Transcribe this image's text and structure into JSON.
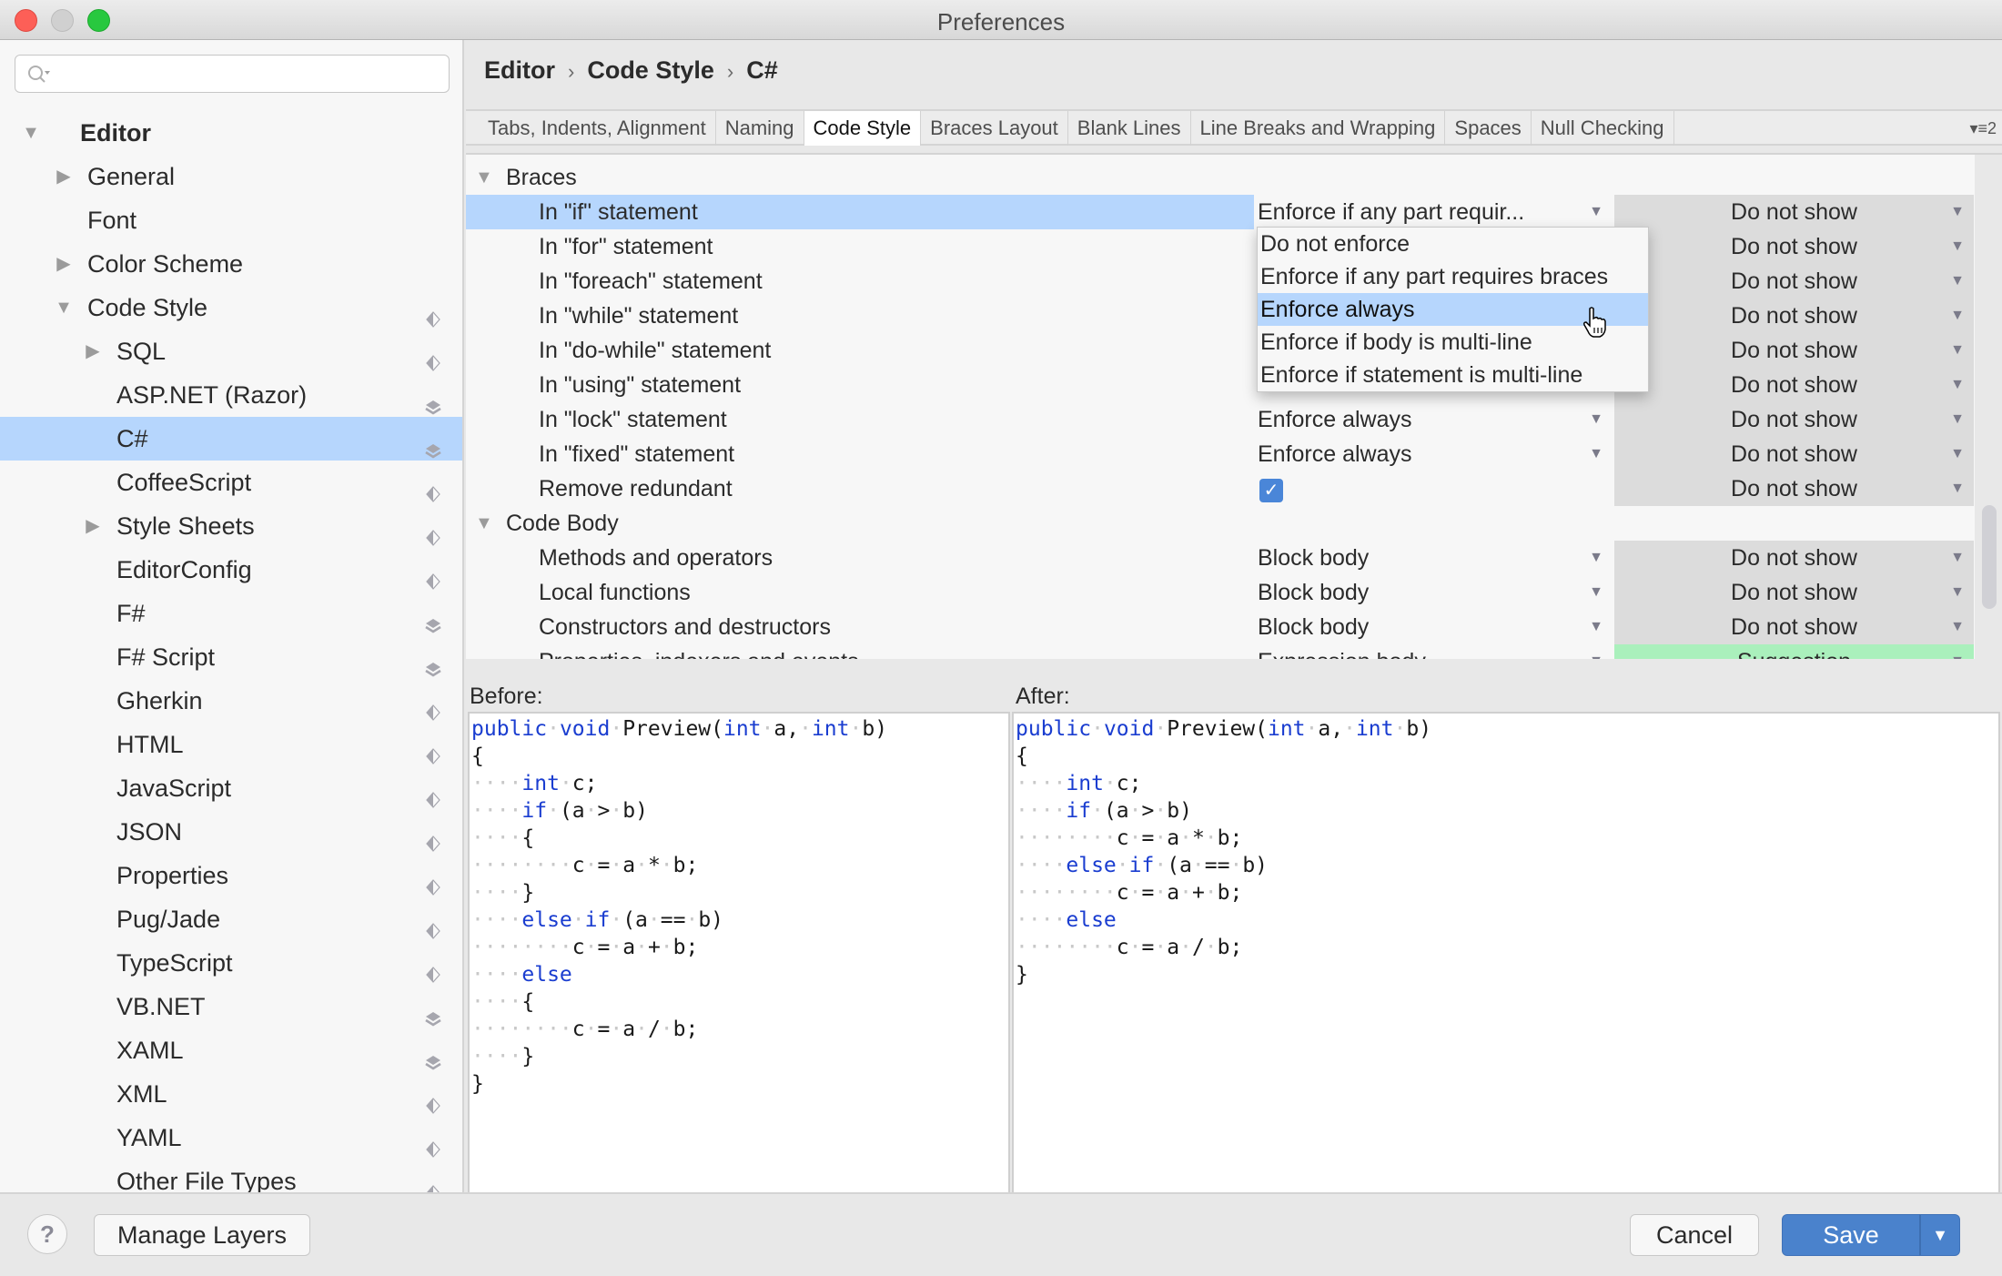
{
  "window": {
    "title": "Preferences"
  },
  "search": {
    "placeholder": ""
  },
  "sidebar": {
    "items": [
      {
        "label": "Editor",
        "level": 0,
        "expander": "expanded",
        "bold": true,
        "layer": ""
      },
      {
        "label": "General",
        "level": 1,
        "expander": "collapsed",
        "layer": ""
      },
      {
        "label": "Font",
        "level": 1,
        "expander": "",
        "layer": ""
      },
      {
        "label": "Color Scheme",
        "level": 1,
        "expander": "collapsed",
        "layer": ""
      },
      {
        "label": "Code Style",
        "level": 1,
        "expander": "expanded",
        "layer": "single"
      },
      {
        "label": "SQL",
        "level": 2,
        "expander": "collapsed",
        "layer": "single"
      },
      {
        "label": "ASP.NET (Razor)",
        "level": 2,
        "expander": "",
        "layer": "multi"
      },
      {
        "label": "C#",
        "level": 2,
        "expander": "",
        "layer": "multi",
        "selected": true
      },
      {
        "label": "CoffeeScript",
        "level": 2,
        "expander": "",
        "layer": "single"
      },
      {
        "label": "Style Sheets",
        "level": 2,
        "expander": "collapsed",
        "layer": "single"
      },
      {
        "label": "EditorConfig",
        "level": 2,
        "expander": "",
        "layer": "single"
      },
      {
        "label": "F#",
        "level": 2,
        "expander": "",
        "layer": "multi"
      },
      {
        "label": "F# Script",
        "level": 2,
        "expander": "",
        "layer": "multi"
      },
      {
        "label": "Gherkin",
        "level": 2,
        "expander": "",
        "layer": "single"
      },
      {
        "label": "HTML",
        "level": 2,
        "expander": "",
        "layer": "single"
      },
      {
        "label": "JavaScript",
        "level": 2,
        "expander": "",
        "layer": "single"
      },
      {
        "label": "JSON",
        "level": 2,
        "expander": "",
        "layer": "single"
      },
      {
        "label": "Properties",
        "level": 2,
        "expander": "",
        "layer": "single"
      },
      {
        "label": "Pug/Jade",
        "level": 2,
        "expander": "",
        "layer": "single"
      },
      {
        "label": "TypeScript",
        "level": 2,
        "expander": "",
        "layer": "single"
      },
      {
        "label": "VB.NET",
        "level": 2,
        "expander": "",
        "layer": "multi"
      },
      {
        "label": "XAML",
        "level": 2,
        "expander": "",
        "layer": "multi"
      },
      {
        "label": "XML",
        "level": 2,
        "expander": "",
        "layer": "single"
      },
      {
        "label": "YAML",
        "level": 2,
        "expander": "",
        "layer": "single"
      },
      {
        "label": "Other File Types",
        "level": 2,
        "expander": "",
        "layer": "single"
      }
    ]
  },
  "breadcrumb": [
    "Editor",
    "Code Style",
    "C#"
  ],
  "breadcrumb_separator": "›",
  "tabs": [
    {
      "label": "Tabs, Indents, Alignment"
    },
    {
      "label": "Naming"
    },
    {
      "label": "Code Style",
      "active": true
    },
    {
      "label": "Braces Layout"
    },
    {
      "label": "Blank Lines"
    },
    {
      "label": "Line Breaks and Wrapping"
    },
    {
      "label": "Spaces"
    },
    {
      "label": "Null Checking"
    }
  ],
  "tabs_overflow": {
    "label": "2"
  },
  "settings": {
    "rows": [
      {
        "type": "group",
        "label": "Braces"
      },
      {
        "type": "setting",
        "label": "In \"if\" statement",
        "value": "Enforce if any part requir...",
        "severity": "Do not show",
        "highlighted": true
      },
      {
        "type": "setting",
        "label": "In \"for\" statement",
        "value": "",
        "severity": "Do not show"
      },
      {
        "type": "setting",
        "label": "In \"foreach\" statement",
        "value": "",
        "severity": "Do not show"
      },
      {
        "type": "setting",
        "label": "In \"while\" statement",
        "value": "",
        "severity": "Do not show"
      },
      {
        "type": "setting",
        "label": "In \"do-while\" statement",
        "value": "",
        "severity": "Do not show"
      },
      {
        "type": "setting",
        "label": "In \"using\" statement",
        "value": "",
        "severity": "Do not show"
      },
      {
        "type": "setting",
        "label": "In \"lock\" statement",
        "value": "Enforce always",
        "severity": "Do not show"
      },
      {
        "type": "setting",
        "label": "In \"fixed\" statement",
        "value": "Enforce always",
        "severity": "Do not show"
      },
      {
        "type": "checkbox",
        "label": "Remove redundant",
        "checked": true,
        "check_glyph": "✓",
        "severity": "Do not show"
      },
      {
        "type": "group",
        "label": "Code Body"
      },
      {
        "type": "setting",
        "label": "Methods and operators",
        "value": "Block body",
        "severity": "Do not show"
      },
      {
        "type": "setting",
        "label": "Local functions",
        "value": "Block body",
        "severity": "Do not show"
      },
      {
        "type": "setting",
        "label": "Constructors and destructors",
        "value": "Block body",
        "severity": "Do not show"
      },
      {
        "type": "setting",
        "label": "Properties, indexers and events",
        "value": "Expression body",
        "severity": "Suggestion",
        "severity_color": "#aaf0bc"
      }
    ]
  },
  "dropdown": {
    "options": [
      "Do not enforce",
      "Enforce if any part requires braces",
      "Enforce always",
      "Enforce if body is multi-line",
      "Enforce if statement is multi-line"
    ],
    "hovered_index": 2
  },
  "preview": {
    "before_label": "Before:",
    "after_label": "After:",
    "before_lines": [
      [
        [
          "kw",
          "public"
        ],
        [
          "ws",
          "·"
        ],
        [
          "kw",
          "void"
        ],
        [
          "ws",
          "·"
        ],
        [
          "t",
          "Preview("
        ],
        [
          "kw",
          "int"
        ],
        [
          "ws",
          "·"
        ],
        [
          "t",
          "a,"
        ],
        [
          "ws",
          "·"
        ],
        [
          "kw",
          "int"
        ],
        [
          "ws",
          "·"
        ],
        [
          "t",
          "b)"
        ]
      ],
      [
        [
          "t",
          "{"
        ]
      ],
      [
        [
          "ws",
          "····"
        ],
        [
          "kw",
          "int"
        ],
        [
          "ws",
          "·"
        ],
        [
          "t",
          "c;"
        ]
      ],
      [
        [
          "ws",
          "····"
        ],
        [
          "kw",
          "if"
        ],
        [
          "ws",
          "·"
        ],
        [
          "t",
          "(a"
        ],
        [
          "ws",
          "·"
        ],
        [
          "t",
          ">"
        ],
        [
          "ws",
          "·"
        ],
        [
          "t",
          "b)"
        ]
      ],
      [
        [
          "ws",
          "····"
        ],
        [
          "t",
          "{"
        ]
      ],
      [
        [
          "ws",
          "········"
        ],
        [
          "t",
          "c"
        ],
        [
          "ws",
          "·"
        ],
        [
          "t",
          "="
        ],
        [
          "ws",
          "·"
        ],
        [
          "t",
          "a"
        ],
        [
          "ws",
          "·"
        ],
        [
          "t",
          "*"
        ],
        [
          "ws",
          "·"
        ],
        [
          "t",
          "b;"
        ]
      ],
      [
        [
          "ws",
          "····"
        ],
        [
          "t",
          "}"
        ]
      ],
      [
        [
          "ws",
          "····"
        ],
        [
          "kw",
          "else"
        ],
        [
          "ws",
          "·"
        ],
        [
          "kw",
          "if"
        ],
        [
          "ws",
          "·"
        ],
        [
          "t",
          "(a"
        ],
        [
          "ws",
          "·"
        ],
        [
          "t",
          "=="
        ],
        [
          "ws",
          "·"
        ],
        [
          "t",
          "b)"
        ]
      ],
      [
        [
          "ws",
          "········"
        ],
        [
          "t",
          "c"
        ],
        [
          "ws",
          "·"
        ],
        [
          "t",
          "="
        ],
        [
          "ws",
          "·"
        ],
        [
          "t",
          "a"
        ],
        [
          "ws",
          "·"
        ],
        [
          "t",
          "+"
        ],
        [
          "ws",
          "·"
        ],
        [
          "t",
          "b;"
        ]
      ],
      [
        [
          "ws",
          "····"
        ],
        [
          "kw",
          "else"
        ]
      ],
      [
        [
          "ws",
          "····"
        ],
        [
          "t",
          "{"
        ]
      ],
      [
        [
          "ws",
          "········"
        ],
        [
          "t",
          "c"
        ],
        [
          "ws",
          "·"
        ],
        [
          "t",
          "="
        ],
        [
          "ws",
          "·"
        ],
        [
          "t",
          "a"
        ],
        [
          "ws",
          "·"
        ],
        [
          "t",
          "/"
        ],
        [
          "ws",
          "·"
        ],
        [
          "t",
          "b;"
        ]
      ],
      [
        [
          "ws",
          "····"
        ],
        [
          "t",
          "}"
        ]
      ],
      [
        [
          "t",
          "}"
        ]
      ]
    ],
    "after_lines": [
      [
        [
          "kw",
          "public"
        ],
        [
          "ws",
          "·"
        ],
        [
          "kw",
          "void"
        ],
        [
          "ws",
          "·"
        ],
        [
          "t",
          "Preview("
        ],
        [
          "kw",
          "int"
        ],
        [
          "ws",
          "·"
        ],
        [
          "t",
          "a,"
        ],
        [
          "ws",
          "·"
        ],
        [
          "kw",
          "int"
        ],
        [
          "ws",
          "·"
        ],
        [
          "t",
          "b)"
        ]
      ],
      [
        [
          "t",
          "{"
        ]
      ],
      [
        [
          "ws",
          "····"
        ],
        [
          "kw",
          "int"
        ],
        [
          "ws",
          "·"
        ],
        [
          "t",
          "c;"
        ]
      ],
      [
        [
          "ws",
          "····"
        ],
        [
          "kw",
          "if"
        ],
        [
          "ws",
          "·"
        ],
        [
          "t",
          "(a"
        ],
        [
          "ws",
          "·"
        ],
        [
          "t",
          ">"
        ],
        [
          "ws",
          "·"
        ],
        [
          "t",
          "b)"
        ]
      ],
      [
        [
          "ws",
          "········"
        ],
        [
          "t",
          "c"
        ],
        [
          "ws",
          "·"
        ],
        [
          "t",
          "="
        ],
        [
          "ws",
          "·"
        ],
        [
          "t",
          "a"
        ],
        [
          "ws",
          "·"
        ],
        [
          "t",
          "*"
        ],
        [
          "ws",
          "·"
        ],
        [
          "t",
          "b;"
        ]
      ],
      [
        [
          "ws",
          "····"
        ],
        [
          "kw",
          "else"
        ],
        [
          "ws",
          "·"
        ],
        [
          "kw",
          "if"
        ],
        [
          "ws",
          "·"
        ],
        [
          "t",
          "(a"
        ],
        [
          "ws",
          "·"
        ],
        [
          "t",
          "=="
        ],
        [
          "ws",
          "·"
        ],
        [
          "t",
          "b)"
        ]
      ],
      [
        [
          "ws",
          "········"
        ],
        [
          "t",
          "c"
        ],
        [
          "ws",
          "·"
        ],
        [
          "t",
          "="
        ],
        [
          "ws",
          "·"
        ],
        [
          "t",
          "a"
        ],
        [
          "ws",
          "·"
        ],
        [
          "t",
          "+"
        ],
        [
          "ws",
          "·"
        ],
        [
          "t",
          "b;"
        ]
      ],
      [
        [
          "ws",
          "····"
        ],
        [
          "kw",
          "else"
        ]
      ],
      [
        [
          "ws",
          "········"
        ],
        [
          "t",
          "c"
        ],
        [
          "ws",
          "·"
        ],
        [
          "t",
          "="
        ],
        [
          "ws",
          "·"
        ],
        [
          "t",
          "a"
        ],
        [
          "ws",
          "·"
        ],
        [
          "t",
          "/"
        ],
        [
          "ws",
          "·"
        ],
        [
          "t",
          "b;"
        ]
      ],
      [
        [
          "t",
          "}"
        ]
      ]
    ]
  },
  "footer": {
    "help_label": "?",
    "manage_layers_label": "Manage Layers",
    "cancel_label": "Cancel",
    "save_label": "Save",
    "save_dropdown_glyph": "▼"
  },
  "colors": {
    "selection": "#b6d6fd",
    "accent_button": "#4a82cc",
    "keyword": "#1a3dd0",
    "suggestion": "#aaf0bc"
  }
}
